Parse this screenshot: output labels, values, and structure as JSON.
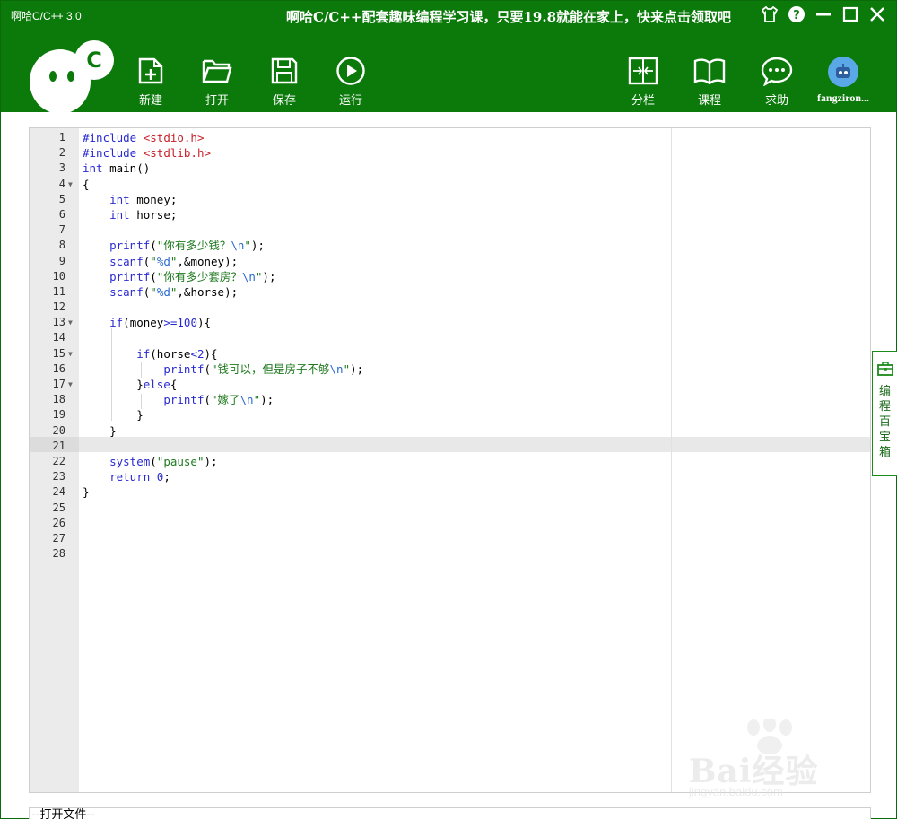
{
  "window": {
    "title": "啊哈C/C++ 3.0",
    "promo": "啊哈C/C++配套趣味编程学习课，只要19.8就能在家上，快来点击领取吧"
  },
  "toolbar": {
    "new_label": "新建",
    "open_label": "打开",
    "save_label": "保存",
    "run_label": "运行",
    "split_label": "分栏",
    "course_label": "课程",
    "help_label": "求助",
    "username": "fangziron..."
  },
  "logo": {
    "letter": "C"
  },
  "editor": {
    "active_line": 21,
    "lines": [
      {
        "n": "1",
        "fold": "",
        "code": "#include <stdio.h>"
      },
      {
        "n": "2",
        "fold": "",
        "code": "#include <stdlib.h>"
      },
      {
        "n": "3",
        "fold": "",
        "code": "int main()"
      },
      {
        "n": "4",
        "fold": "▼",
        "code": "{"
      },
      {
        "n": "5",
        "fold": "",
        "code": "    int money;"
      },
      {
        "n": "6",
        "fold": "",
        "code": "    int horse;"
      },
      {
        "n": "7",
        "fold": "",
        "code": ""
      },
      {
        "n": "8",
        "fold": "",
        "code": "    printf(\"你有多少钱？\\n\");"
      },
      {
        "n": "9",
        "fold": "",
        "code": "    scanf(\"%d\",&money);"
      },
      {
        "n": "10",
        "fold": "",
        "code": "    printf(\"你有多少套房？\\n\");"
      },
      {
        "n": "11",
        "fold": "",
        "code": "    scanf(\"%d\",&horse);"
      },
      {
        "n": "12",
        "fold": "",
        "code": ""
      },
      {
        "n": "13",
        "fold": "▼",
        "code": "    if(money>=100){"
      },
      {
        "n": "14",
        "fold": "",
        "code": ""
      },
      {
        "n": "15",
        "fold": "▼",
        "code": "        if(horse<2){"
      },
      {
        "n": "16",
        "fold": "",
        "code": "            printf(\"钱可以，但是房子不够\\n\");"
      },
      {
        "n": "17",
        "fold": "▼",
        "code": "        }else{"
      },
      {
        "n": "18",
        "fold": "",
        "code": "            printf(\"嫁了\\n\");"
      },
      {
        "n": "19",
        "fold": "",
        "code": "        }"
      },
      {
        "n": "20",
        "fold": "",
        "code": "    }"
      },
      {
        "n": "21",
        "fold": "",
        "code": ""
      },
      {
        "n": "22",
        "fold": "",
        "code": "    system(\"pause\");"
      },
      {
        "n": "23",
        "fold": "",
        "code": "    return 0;"
      },
      {
        "n": "24",
        "fold": "",
        "code": "}"
      },
      {
        "n": "25",
        "fold": "",
        "code": ""
      },
      {
        "n": "26",
        "fold": "",
        "code": ""
      },
      {
        "n": "27",
        "fold": "",
        "code": ""
      },
      {
        "n": "28",
        "fold": "",
        "code": ""
      }
    ]
  },
  "side_tab": {
    "label": "编程百宝箱"
  },
  "bottom_pane": {
    "text": "--打开文件--"
  },
  "watermark": {
    "brand": "Bai经验",
    "url": "jingyan.baidu.com"
  },
  "colors": {
    "header_green": "#0b7a0b",
    "keyword": "#2a2ad2",
    "string": "#1f7a1f",
    "include": "#c8202a"
  }
}
